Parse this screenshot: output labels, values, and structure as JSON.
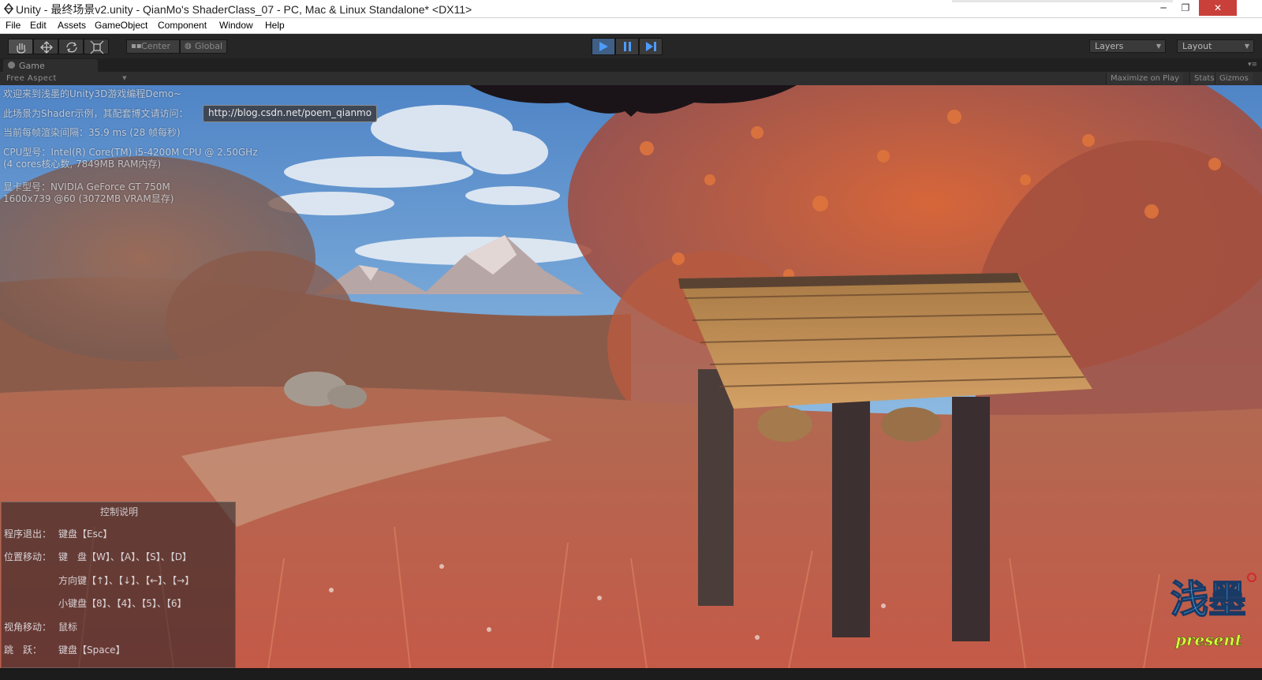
{
  "window": {
    "title": "Unity - 最终场景v2.unity - QianMo's ShaderClass_07 - PC, Mac & Linux Standalone* <DX11>",
    "minimize_glyph": "─",
    "maximize_glyph": "❐",
    "close_glyph": "✕"
  },
  "menu": {
    "items": [
      {
        "label": "File"
      },
      {
        "label": "Edit"
      },
      {
        "label": "Assets"
      },
      {
        "label": "GameObject"
      },
      {
        "label": "Component"
      },
      {
        "label": "Window"
      },
      {
        "label": "Help"
      }
    ]
  },
  "toolbar": {
    "tools": [
      "hand-icon",
      "move-icon",
      "rotate-icon",
      "scale-icon"
    ],
    "pivot_label": "Center",
    "space_label": "Global",
    "playback": {
      "play": "play-icon",
      "pause": "pause-icon",
      "step": "step-icon"
    },
    "layers_label": "Layers",
    "layout_label": "Layout"
  },
  "game_view": {
    "tab_label": "Game",
    "aspect_label": "Free Aspect",
    "maximize_label": "Maximize on Play",
    "stats_label": "Stats",
    "gizmos_label": "Gizmos"
  },
  "overlay": {
    "welcome": "欢迎来到浅墨的Unity3D游戏编程Demo~",
    "shader_note": "此场景为Shader示例，其配套博文请访问：",
    "blog_url": "http://blog.csdn.net/poem_qianmo",
    "frame_time": "当前每帧渲染间隔：35.9 ms (28 帧每秒)",
    "cpu_line1": "CPU型号：Intel(R) Core(TM) i5-4200M CPU @ 2.50GHz",
    "cpu_line2": "(4 cores核心数, 7849MB RAM内存)",
    "gpu_line1": "显卡型号：NVIDIA GeForce GT 750M",
    "gpu_line2": "1600x739 @60 (3072MB VRAM显存)"
  },
  "controls": {
    "title": "控制说明",
    "exit_label": "程序退出：",
    "exit_value": "键盘【Esc】",
    "move_label": "位置移动：",
    "move_keys": "键　盘【W】、【A】、【S】、【D】",
    "move_arrows": "方向键【↑】、【↓】、【←】、【→】",
    "move_numpad": "小键盘【8】、【4】、【5】、【6】",
    "view_label": "视角移动：",
    "view_value": "鼠标",
    "jump_label": "跳　跃：",
    "jump_value": "键盘【Space】"
  },
  "logo": {
    "chars": "浅墨",
    "tagline": "present"
  }
}
